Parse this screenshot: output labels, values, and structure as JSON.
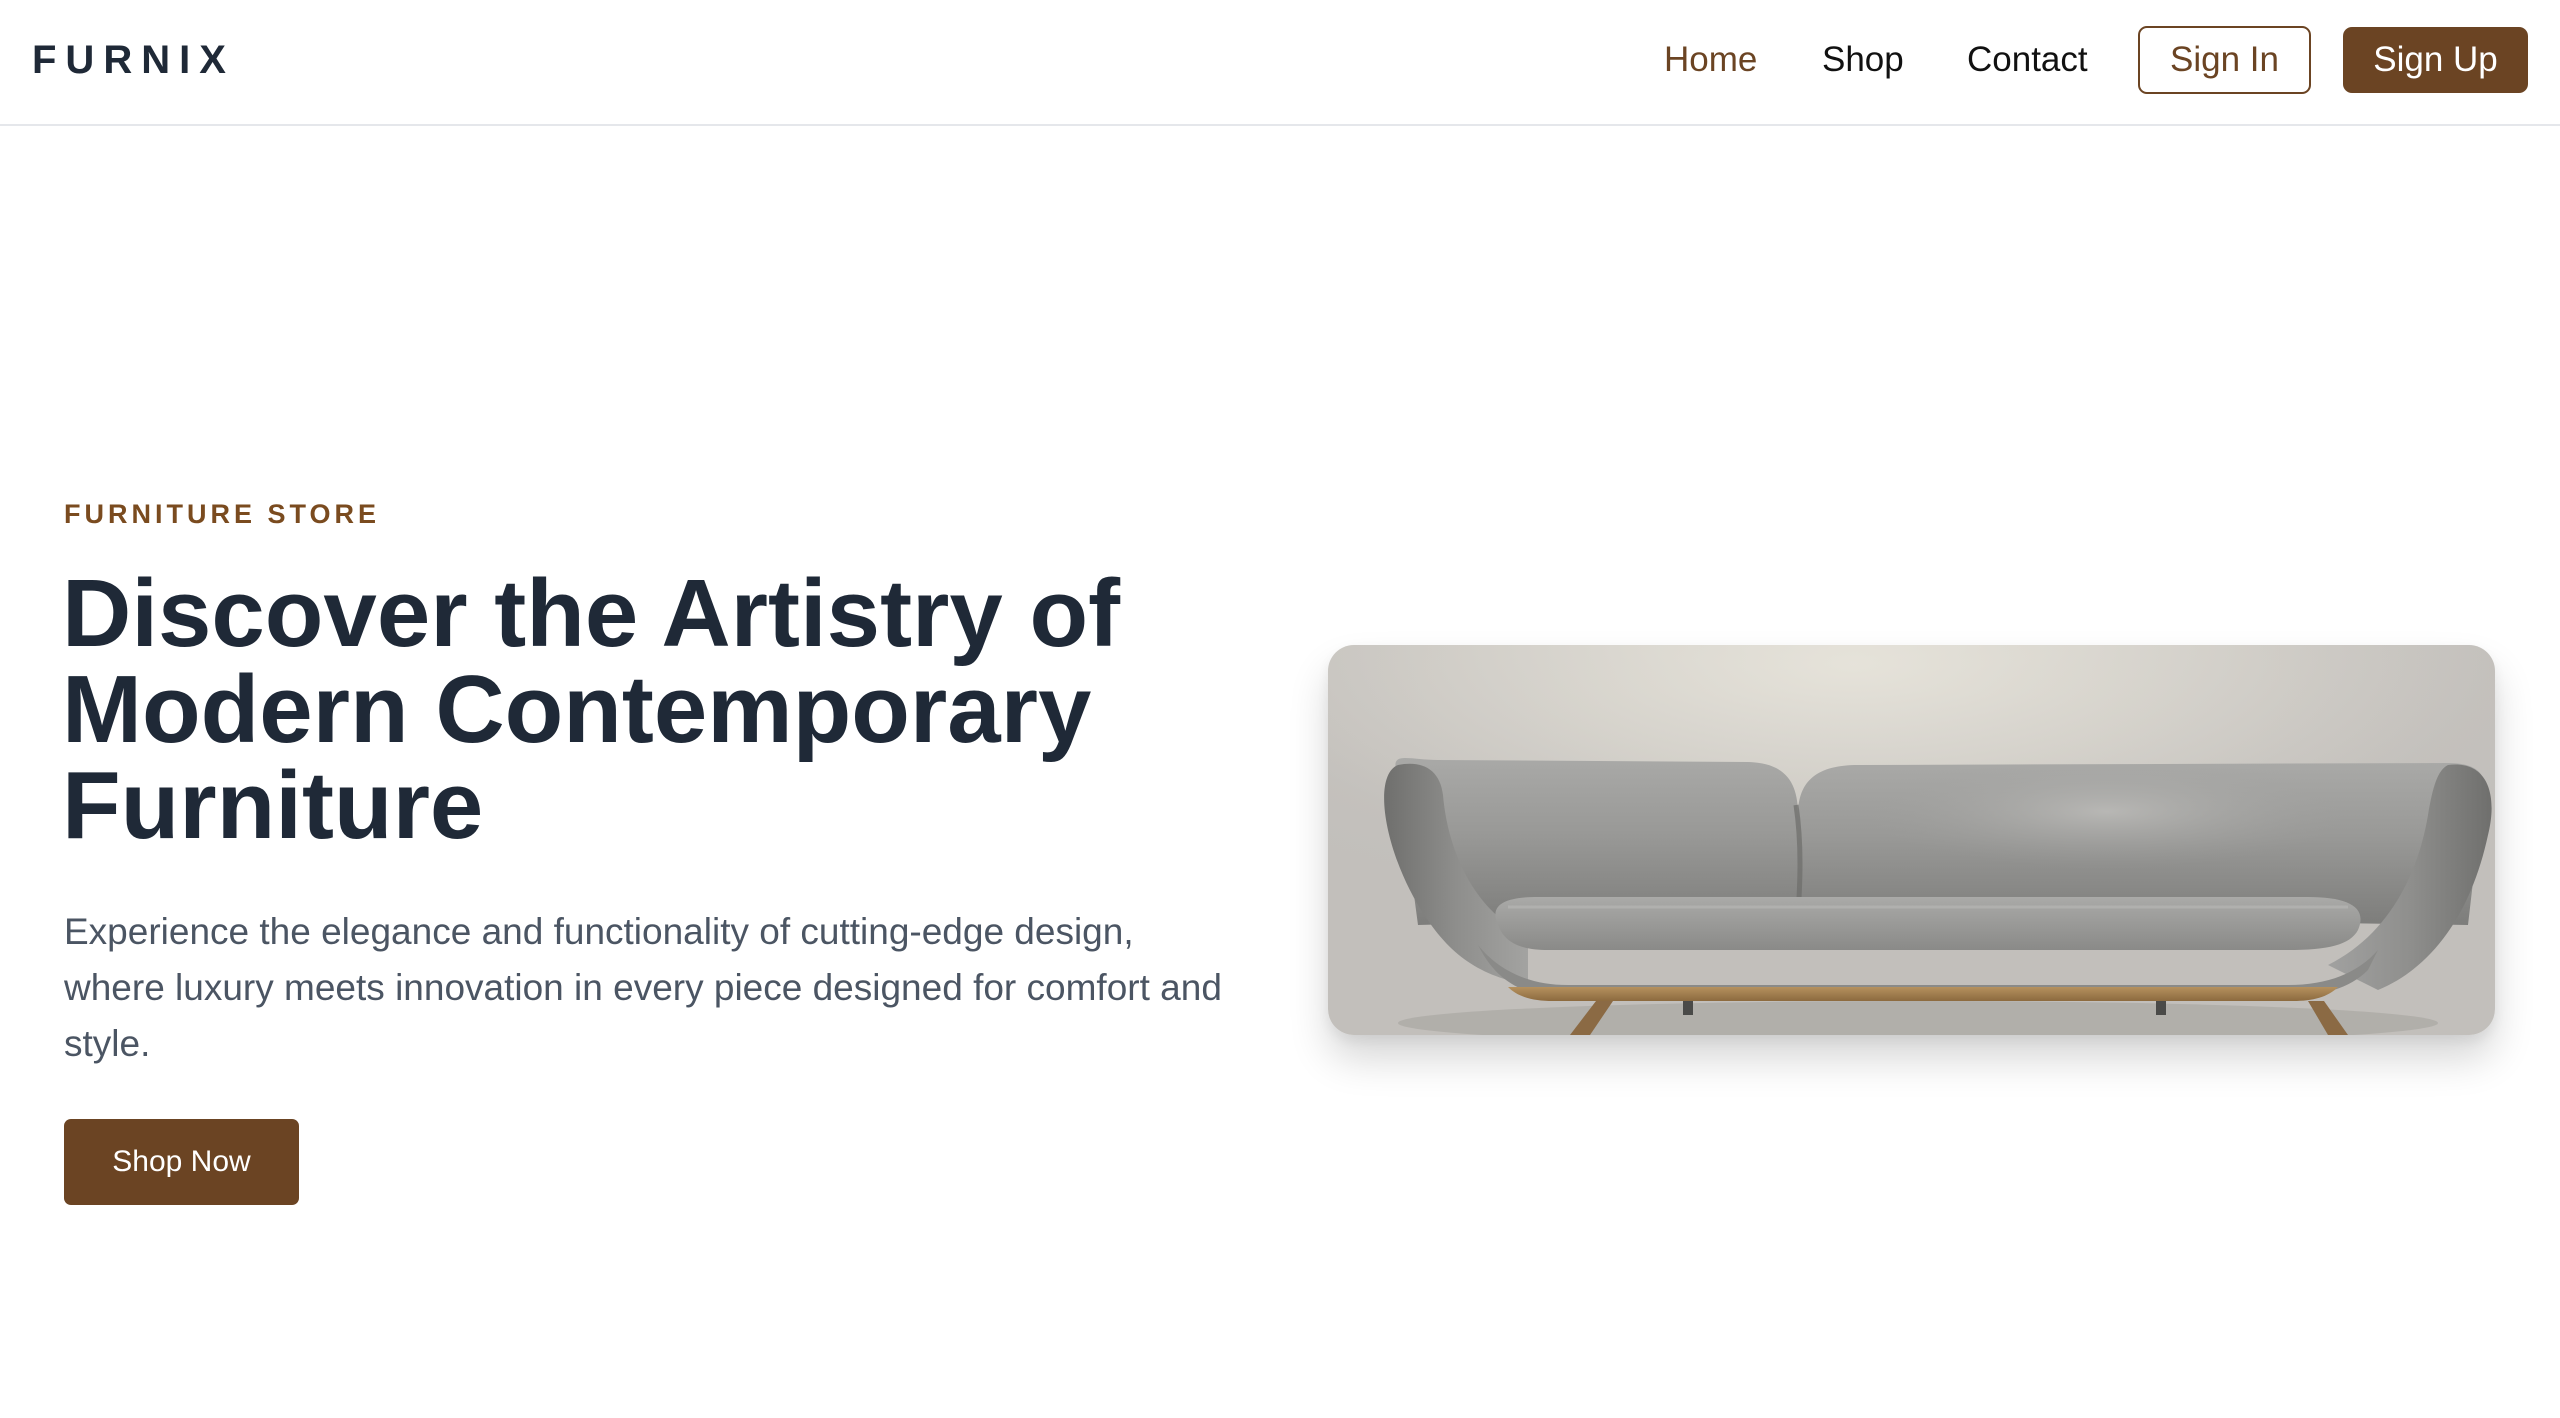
{
  "brand": {
    "logo_text": "FURNIX"
  },
  "nav": {
    "links": [
      {
        "label": "Home",
        "active": true
      },
      {
        "label": "Shop",
        "active": false
      },
      {
        "label": "Contact",
        "active": false
      }
    ],
    "sign_in_label": "Sign In",
    "sign_up_label": "Sign Up"
  },
  "hero": {
    "eyebrow": "FURNITURE STORE",
    "title_lines": [
      "Discover the Artistry of",
      "Modern Contemporary",
      "Furniture"
    ],
    "description": "Experience the elegance and functionality of cutting-edge design, where luxury meets innovation in every piece designed for comfort and style.",
    "cta_label": "Shop Now",
    "image_subject": "grey-leather-sofa"
  },
  "colors": {
    "accent": "#6b4423",
    "eyebrow": "#7a4b1f",
    "heading": "#1f2937",
    "body_text": "#4b5563",
    "border": "#e5e7eb"
  }
}
